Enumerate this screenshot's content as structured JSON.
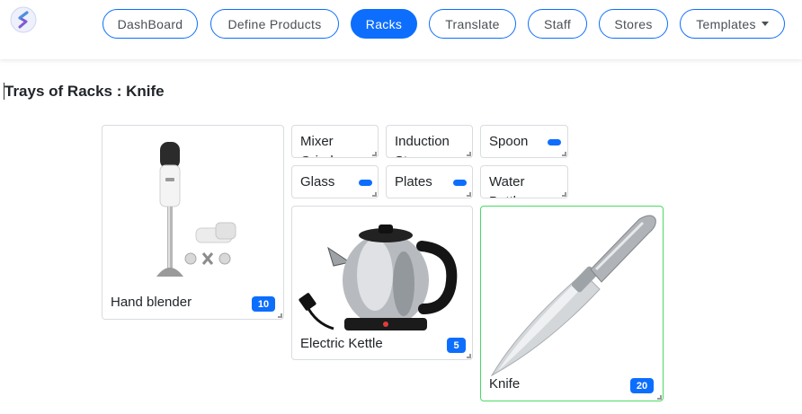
{
  "nav": {
    "items": [
      {
        "label": "DashBoard"
      },
      {
        "label": "Define Products"
      },
      {
        "label": "Racks"
      },
      {
        "label": "Translate"
      },
      {
        "label": "Staff"
      },
      {
        "label": "Stores"
      },
      {
        "label": "Templates"
      }
    ],
    "active": "Racks",
    "accent_color": "#0d6efd"
  },
  "page": {
    "title": "Trays of Racks : Knife"
  },
  "trays": {
    "hand_blender": {
      "label": "Hand blender",
      "count": "10",
      "icon": "hand-blender-image"
    },
    "mixer_grinder": {
      "label": "Mixer Grinder"
    },
    "induction_stove": {
      "label": "Induction Stove"
    },
    "spoon": {
      "label": "Spoon"
    },
    "glass": {
      "label": "Glass"
    },
    "plates": {
      "label": "Plates"
    },
    "water_bottle": {
      "label": "Water Bottle"
    },
    "electric_kettle": {
      "label": "Electric Kettle",
      "count": "5",
      "icon": "electric-kettle-image"
    },
    "knife": {
      "label": "Knife",
      "count": "20",
      "icon": "knife-image",
      "selected": true
    }
  }
}
